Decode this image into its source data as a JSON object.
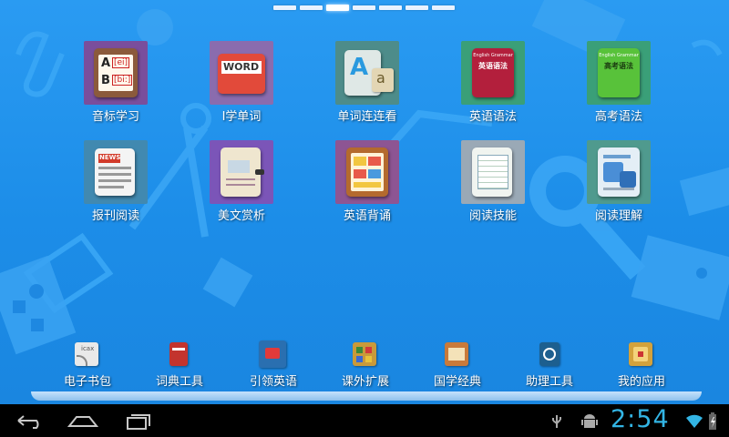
{
  "launcher": {
    "page_count": 7,
    "active_page": 3,
    "apps": [
      {
        "label": "音标学习",
        "icon": "phonetics-icon",
        "tile_color": "#7a4e9c",
        "icon_color": "#8b5a3c"
      },
      {
        "label": "I学单词",
        "icon": "word-book-icon",
        "tile_color": "#8a6cae",
        "icon_color": "#e24a3a"
      },
      {
        "label": "单词连连看",
        "icon": "letters-match-icon",
        "tile_color": "#4d8c8a",
        "icon_color": "#dfe8e6"
      },
      {
        "label": "英语语法",
        "icon": "english-grammar-book-icon",
        "tile_color": "#3a9f78",
        "icon_color": "#b31f3c"
      },
      {
        "label": "高考语法",
        "icon": "exam-grammar-book-icon",
        "tile_color": "#3a9f78",
        "icon_color": "#58c23a"
      },
      {
        "label": "报刊阅读",
        "icon": "newspaper-icon",
        "tile_color": "#4189b0",
        "icon_color": "#f4f4f4"
      },
      {
        "label": "美文赏析",
        "icon": "notebook-icon",
        "tile_color": "#7b55b8",
        "icon_color": "#efe6cf"
      },
      {
        "label": "英语背诵",
        "icon": "recitation-icon",
        "tile_color": "#8d5593",
        "icon_color": "#b46a2e"
      },
      {
        "label": "阅读技能",
        "icon": "reading-document-icon",
        "tile_color": "#9aa9b6",
        "icon_color": "#f0f4f0"
      },
      {
        "label": "阅读理解",
        "icon": "comprehension-document-icon",
        "tile_color": "#4f9a8e",
        "icon_color": "#e4eef6"
      }
    ],
    "icon_texts": {
      "phonetics_a": "A",
      "phonetics_a_ipa": "[ei]",
      "phonetics_b": "B",
      "phonetics_b_ipa": "[bi:]",
      "word": "WORD",
      "letter_big": "A",
      "letter_small": "a",
      "grammar_en": "English Grammar",
      "grammar_cn": "英语语法",
      "exam_en": "English Grammar",
      "exam_cn": "高考语法",
      "news": "NEWS"
    }
  },
  "dock": {
    "items": [
      {
        "label": "电子书包",
        "icon": "ebook-bag-icon",
        "icon_color": "#e9e9e9"
      },
      {
        "label": "词典工具",
        "icon": "dictionary-icon",
        "icon_color": "#c3342e"
      },
      {
        "label": "引领英语",
        "icon": "lead-english-icon",
        "icon_color": "#2a6fb0"
      },
      {
        "label": "课外扩展",
        "icon": "extension-icon",
        "icon_color": "#c99a3a"
      },
      {
        "label": "国学经典",
        "icon": "classics-icon",
        "icon_color": "#c97a3a"
      },
      {
        "label": "助理工具",
        "icon": "assistant-tools-icon",
        "icon_color": "#1d5f8f"
      },
      {
        "label": "我的应用",
        "icon": "my-apps-icon",
        "icon_color": "#d4a23c"
      }
    ],
    "ebook_text": "icax"
  },
  "navbar": {
    "clock": "2:54",
    "accent": "#33b5e5"
  }
}
